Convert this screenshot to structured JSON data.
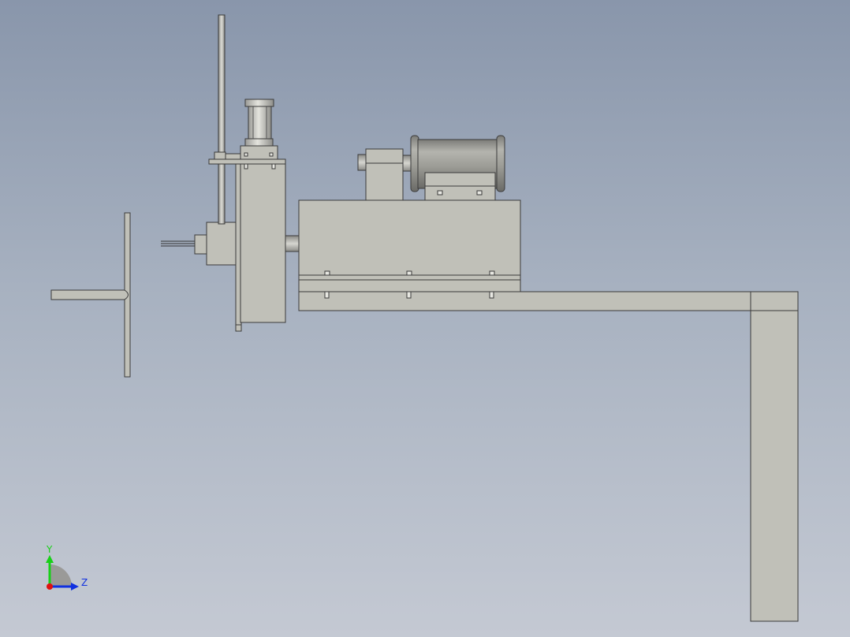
{
  "viewport": {
    "background_top": "#8996ab",
    "background_bottom": "#c4c9d3"
  },
  "model": {
    "body_color": "#c0c0b8",
    "edge_color": "#3a3a3a",
    "steel_color": "#a8a8a4",
    "components": [
      "handwheel",
      "cylinder-rod",
      "air-cylinder",
      "vertical-slide-plate",
      "lead-screw-block",
      "spindle-housing",
      "gear-reducer",
      "motor",
      "base-beam",
      "support-leg"
    ]
  },
  "triad": {
    "y_label": "Y",
    "z_label": "Z",
    "x_color": "#e01010",
    "y_color": "#18d018",
    "z_color": "#1030e0"
  }
}
